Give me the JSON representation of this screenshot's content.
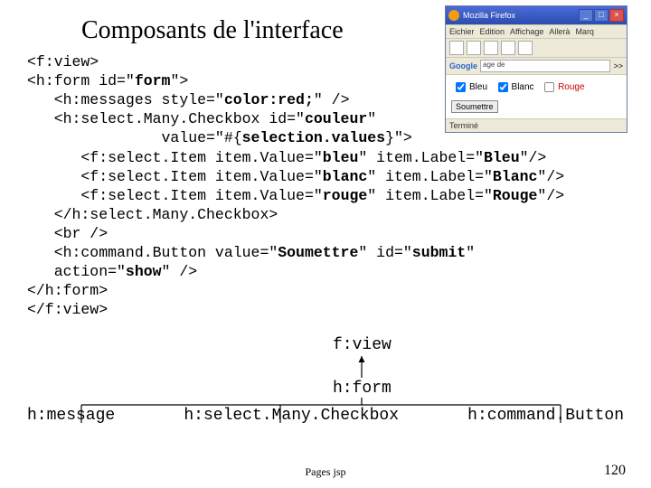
{
  "title": "Composants de l'interface",
  "browser": {
    "app_title": "Mozilla Firefox",
    "menu": [
      "Eichier",
      "Edition",
      "Affichage",
      "Allerà",
      "Marq"
    ],
    "url_text": "age de",
    "brand": "Google",
    "tabs_go": ">>",
    "checkboxes": [
      {
        "label": "Bleu",
        "checked": true
      },
      {
        "label": "Blanc",
        "checked": true
      },
      {
        "label": "Rouge",
        "checked": false
      }
    ],
    "submit": "Soumettre",
    "status": "Terminé"
  },
  "code": {
    "l1": "<f:view>",
    "l2a": "<h:form id=\"",
    "l2b": "form",
    "l2c": "\">",
    "l3a": "   <h:messages style=\"",
    "l3b": "color:red;",
    "l3c": "\" />",
    "l4a": "   <h:select.Many.Checkbox id=\"",
    "l4b": "couleur",
    "l4c": "\"",
    "l5a": "               value=\"#{",
    "l5b": "selection.values",
    "l5c": "}\">",
    "l6a": "      <f:select.Item item.Value=\"",
    "l6b": "bleu",
    "l6c": "\" item.Label=\"",
    "l6d": "Bleu",
    "l6e": "\"/>",
    "l7a": "      <f:select.Item item.Value=\"",
    "l7b": "blanc",
    "l7c": "\" item.Label=\"",
    "l7d": "Blanc",
    "l7e": "\"/>",
    "l8a": "      <f:select.Item item.Value=\"",
    "l8b": "rouge",
    "l8c": "\" item.Label=\"",
    "l8d": "Rouge",
    "l8e": "\"/>",
    "l9": "   </h:select.Many.Checkbox>",
    "l10": "   <br />",
    "l11a": "   <h:command.Button value=\"",
    "l11b": "Soumettre",
    "l11c": "\" id=\"",
    "l11d": "submit",
    "l11e": "\"",
    "l12a": "   action=\"",
    "l12b": "show",
    "l12c": "\" />",
    "l13": "</h:form>",
    "l14": "</f:view>"
  },
  "diagram": {
    "root": "f:view",
    "mid": "h:form",
    "leaves": [
      "h:message",
      "h:select.Many.Checkbox",
      "h:command.Button"
    ]
  },
  "footer": "Pages jsp",
  "page_number": "120"
}
